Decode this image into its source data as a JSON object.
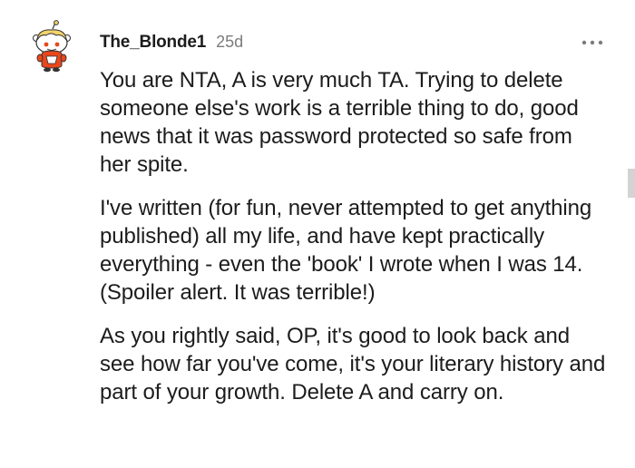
{
  "comment": {
    "username": "The_Blonde1",
    "age": "25d",
    "avatar_icon": "snoo-avatar-icon",
    "more_icon": "more-options-icon",
    "paragraphs": [
      "You are NTA, A is very much TA. Trying to delete someone else's work is a terrible thing to do, good news that it was password protected so safe from her spite.",
      "I've written (for fun, never attempted to get anything published) all my life, and have kept practically everything - even the 'book' I wrote when I was 14. (Spoiler alert. It was terrible!)",
      "As you rightly said, OP, it's good to look back and see how far you've come, it's your literary history and part of your growth. Delete A and carry on."
    ]
  },
  "colors": {
    "text": "#1c1c1c",
    "meta": "#7c7c7c",
    "avatar_shirt": "#e8471c",
    "avatar_hair": "#f3d36b"
  }
}
